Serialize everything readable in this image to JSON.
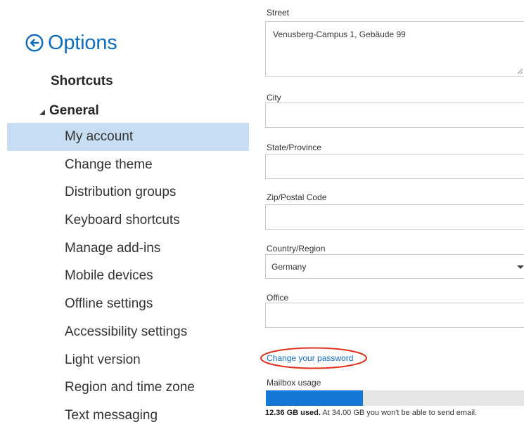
{
  "header": {
    "title": "Options",
    "back_icon": "arrow-left-circle-icon"
  },
  "nav": {
    "shortcuts": "Shortcuts",
    "general": "General",
    "items": [
      {
        "label": "My account",
        "selected": true
      },
      {
        "label": "Change theme",
        "selected": false
      },
      {
        "label": "Distribution groups",
        "selected": false
      },
      {
        "label": "Keyboard shortcuts",
        "selected": false
      },
      {
        "label": "Manage add-ins",
        "selected": false
      },
      {
        "label": "Mobile devices",
        "selected": false
      },
      {
        "label": "Offline settings",
        "selected": false
      },
      {
        "label": "Accessibility settings",
        "selected": false
      },
      {
        "label": "Light version",
        "selected": false
      },
      {
        "label": "Region and time zone",
        "selected": false
      },
      {
        "label": "Text messaging",
        "selected": false
      }
    ]
  },
  "form": {
    "street": {
      "label": "Street",
      "value": "Venusberg-Campus 1, Gebäude 99"
    },
    "city": {
      "label": "City",
      "value": ""
    },
    "state": {
      "label": "State/Province",
      "value": ""
    },
    "zip": {
      "label": "Zip/Postal Code",
      "value": ""
    },
    "country": {
      "label": "Country/Region",
      "value": "Germany"
    },
    "office": {
      "label": "Office",
      "value": ""
    },
    "change_password": "Change your password",
    "mailbox": {
      "label": "Mailbox usage",
      "used_text": "12.36 GB used.",
      "limit_text": "At 34.00 GB you won't be able to send email.",
      "used_gb": 12.36,
      "limit_gb": 34.0
    }
  },
  "colors": {
    "accent": "#0f6cbd",
    "selected_bg": "#c7ddf1",
    "usage_fill": "#1478d4",
    "annotation_circle": "#e0301e"
  }
}
